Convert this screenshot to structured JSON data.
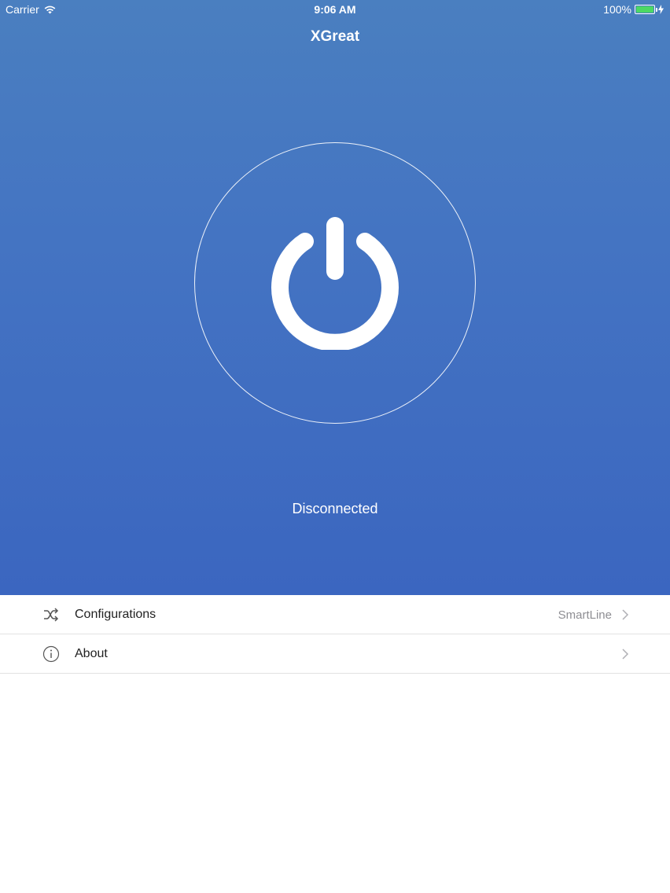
{
  "statusbar": {
    "carrier": "Carrier",
    "time": "9:06 AM",
    "battery": "100%"
  },
  "header": {
    "title": "XGreat"
  },
  "connection": {
    "status": "Disconnected"
  },
  "menu": {
    "items": [
      {
        "label": "Configurations",
        "value": "SmartLine",
        "icon": "shuffle-icon"
      },
      {
        "label": "About",
        "value": "",
        "icon": "info-icon"
      }
    ]
  },
  "colors": {
    "hero_top": "#4a7fc0",
    "hero_bottom": "#3b66c0",
    "battery": "#4cd964"
  }
}
